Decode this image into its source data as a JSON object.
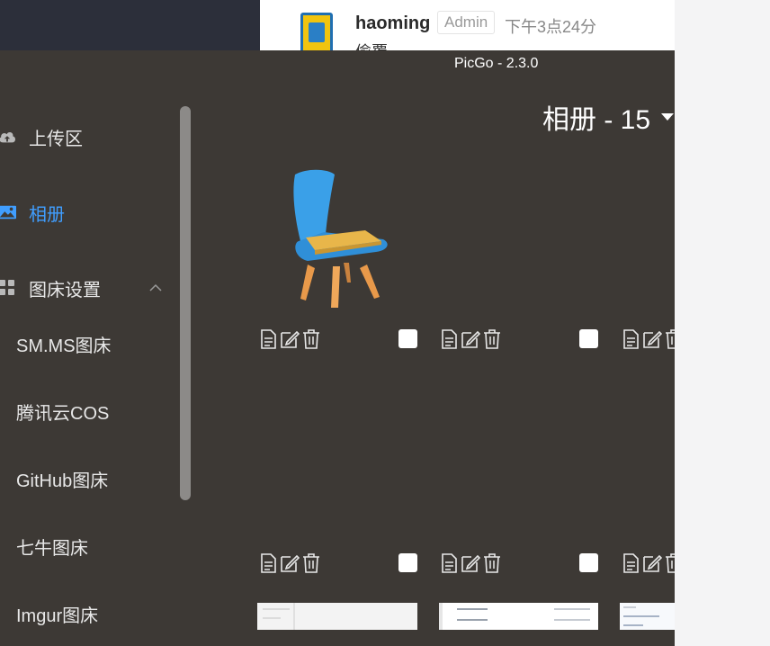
{
  "background_post": {
    "username": "haoming",
    "role_badge": "Admin",
    "time": "下午3点24分",
    "text_tail": "偷覆"
  },
  "window": {
    "title": "PicGo - 2.3.0"
  },
  "sidebar": {
    "items": [
      {
        "label": "上传区",
        "icon": "cloud-upload-icon"
      },
      {
        "label": "相册",
        "icon": "image-icon"
      },
      {
        "label": "图床设置",
        "icon": "grid-icon"
      }
    ],
    "submenu": [
      {
        "label": "SM.MS图床"
      },
      {
        "label": "腾讯云COS"
      },
      {
        "label": "GitHub图床"
      },
      {
        "label": "七牛图床"
      },
      {
        "label": "Imgur图床"
      }
    ]
  },
  "album": {
    "title": "相册 - 15"
  },
  "colors": {
    "active": "#409eff",
    "window_bg": "#3d3935",
    "chair_blue": "#3aa0e8",
    "chair_seat": "#e8b64a",
    "chair_legs": "#e89a4a"
  }
}
